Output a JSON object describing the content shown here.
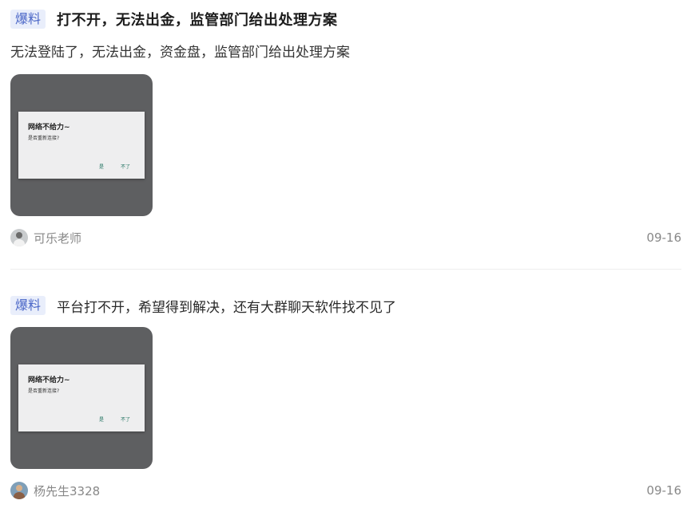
{
  "posts": [
    {
      "tag": "爆料",
      "title": "打不开，无法出金，监管部门给出处理方案",
      "summary": "无法登陆了，无法出金，资金盘，监管部门给出处理方案",
      "thumbnail": {
        "dialog_title": "网络不给力~",
        "dialog_message": "是否重新连接?",
        "dialog_yes": "是",
        "dialog_no": "不了"
      },
      "author": "可乐老师",
      "date": "09-16"
    },
    {
      "tag": "爆料",
      "title": "平台打不开，希望得到解决，还有大群聊天软件找不见了",
      "thumbnail": {
        "dialog_title": "网络不给力~",
        "dialog_message": "是否重新连接?",
        "dialog_yes": "是",
        "dialog_no": "不了"
      },
      "author": "杨先生3328",
      "date": "09-16"
    }
  ],
  "colors": {
    "tag_bg": "#e9eefb",
    "tag_text": "#4a66c7",
    "thumb_bg": "#5e5f61",
    "meta_text": "#888888"
  }
}
